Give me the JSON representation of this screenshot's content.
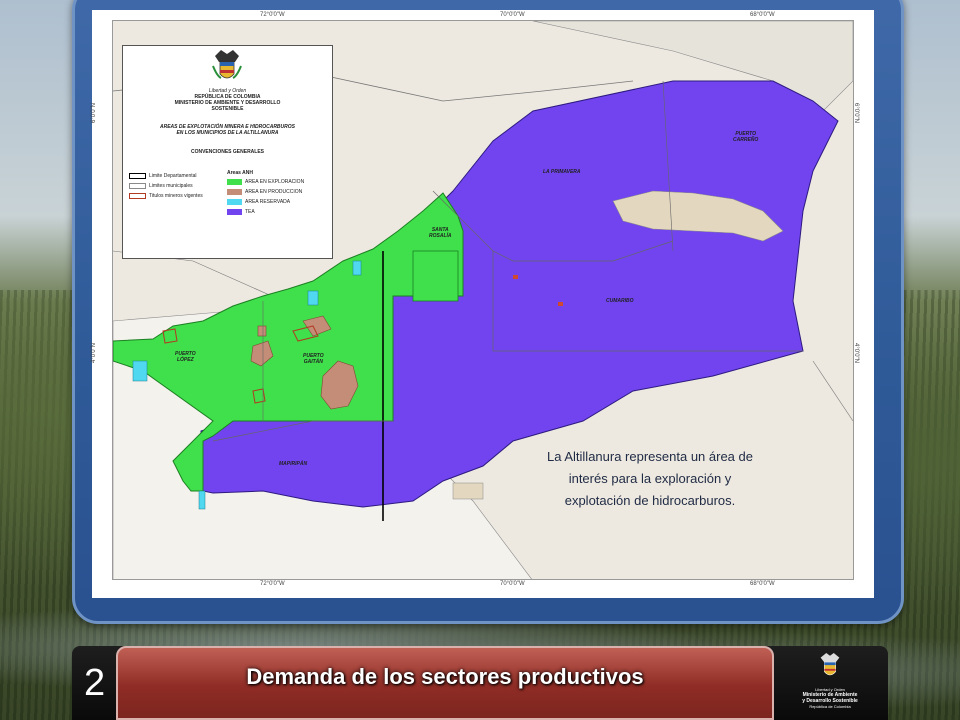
{
  "map": {
    "coordinates": {
      "top": [
        "72°0'0\"W",
        "70°0'0\"W",
        "68°0'0\"W"
      ],
      "bottom": [
        "72°0'0\"W",
        "70°0'0\"W",
        "68°0'0\"W"
      ],
      "left": [
        "6°0'0\"N",
        "4°0'0\"N"
      ],
      "right": [
        "6°0'0\"N",
        "4°0'0\"N"
      ]
    },
    "legend": {
      "motto": "Libertad y Orden",
      "country": "REPÚBLICA DE COLOMBIA",
      "ministry_line1": "MINISTERIO DE AMBIENTE Y DESARROLLO",
      "ministry_line2": "SOSTENIBLE",
      "subtitle_line1": "AREAS DE EXPLOTACIÓN MINERA E HIDROCARBUROS",
      "subtitle_line2": "EN LOS MUNICIPIOS DE LA ALTILLANURA",
      "conventions": "CONVENCIONES GENERALES",
      "boundaries": [
        {
          "label": "Limite Departamental",
          "color": "#000000"
        },
        {
          "label": "Limites municipales",
          "color": "#8a8a8a"
        },
        {
          "label": "Titulos mineros vigentes",
          "color": "#b23a20"
        }
      ],
      "anh_title": "Areas ANH",
      "anh_areas": [
        {
          "label": "AREA EN EXPLORACION",
          "color": "#3fe04b"
        },
        {
          "label": "AREA EN PRODUCCION",
          "color": "#c38d78"
        },
        {
          "label": "AREA RESERVADA",
          "color": "#4fd8f0"
        },
        {
          "label": "TEA",
          "color": "#7144f0"
        }
      ]
    },
    "places": {
      "la_primavera": "LA PRIMAVERA",
      "puerto_carreno_1": "PUERTO",
      "puerto_carreno_2": "CARREÑO",
      "santa_rosalia_1": "SANTA",
      "santa_rosalia_2": "ROSALÍA",
      "cumaribo": "CUMARIBO",
      "puerto_lopez_1": "PUERTO",
      "puerto_lopez_2": "LÓPEZ",
      "puerto_gaitan_1": "PUERTO",
      "puerto_gaitan_2": "GAITÁN",
      "mapiripan": "MAPIRIPÁN"
    }
  },
  "info_text": "La Altillanura representa un área de interés para la exploración y explotación de hidrocarburos.",
  "footer": {
    "section_number": "2",
    "section_title": "Demanda de los sectores productivos",
    "logo_motto": "Libertad y Orden",
    "logo_ministry_1": "Ministerio de Ambiente",
    "logo_ministry_2": "y Desarrollo Sostenible",
    "logo_country": "República de Colombia"
  }
}
